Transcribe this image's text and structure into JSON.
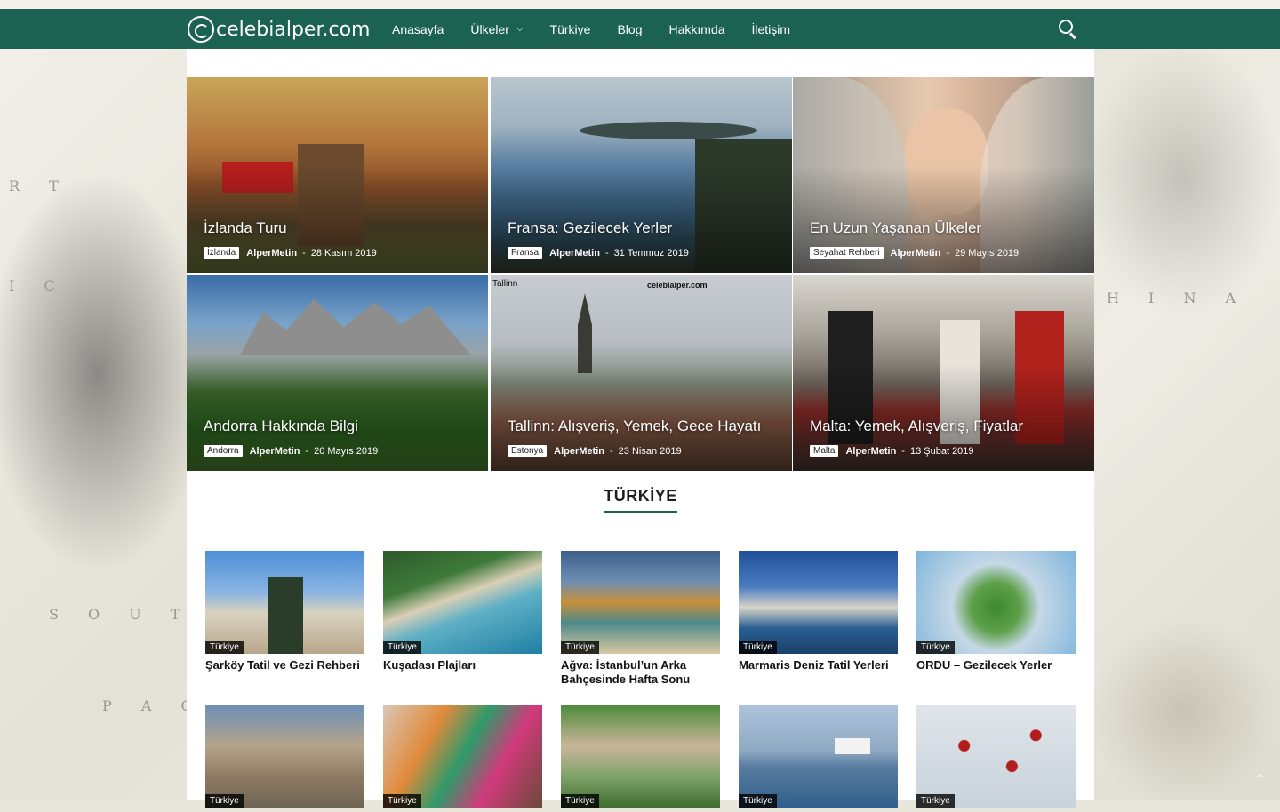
{
  "site": {
    "logo_text": "celebialper.com",
    "nav": [
      {
        "label": "Anasayfa"
      },
      {
        "label": "Ülkeler",
        "has_dropdown": true
      },
      {
        "label": "Türkiye"
      },
      {
        "label": "Blog"
      },
      {
        "label": "Hakkımda"
      },
      {
        "label": "İletişim"
      }
    ],
    "background_map_labels": [
      "R T",
      "I C",
      "S O U T H",
      "P A C I F",
      "H I N A"
    ],
    "theme_color": "#1b6253"
  },
  "featured": [
    {
      "title": "İzlanda Turu",
      "category": "İzlanda",
      "author": "AlperMetin",
      "date": "28 Kasım 2019"
    },
    {
      "title": "Fransa: Gezilecek Yerler",
      "category": "Fransa",
      "author": "AlperMetin",
      "date": "31 Temmuz 2019"
    },
    {
      "title": "En Uzun Yaşanan Ülkeler",
      "category": "Seyahat Rehberi",
      "author": "AlperMetin",
      "date": "29 Mayıs 2019"
    },
    {
      "title": "Andorra Hakkında Bilgi",
      "category": "Andorra",
      "author": "AlperMetin",
      "date": "20 Mayıs 2019"
    },
    {
      "title": "Tallinn: Alışveriş, Yemek, Gece Hayatı",
      "category": "Estonya",
      "author": "AlperMetin",
      "date": "23 Nisan 2019",
      "image_text": {
        "left": "Tallinn",
        "right": "celebialper.com"
      }
    },
    {
      "title": "Malta: Yemek, Alışveriş, Fiyatlar",
      "category": "Malta",
      "author": "AlperMetin",
      "date": "13 Şubat 2019"
    }
  ],
  "section": {
    "title": "TÜRKİYE",
    "cards": [
      {
        "badge": "Türkiye",
        "title": "Şarköy Tatil ve Gezi Rehberi"
      },
      {
        "badge": "Türkiye",
        "title": "Kuşadası Plajları"
      },
      {
        "badge": "Türkiye",
        "title": "Ağva: İstanbul’un Arka Bahçesinde Hafta Sonu"
      },
      {
        "badge": "Türkiye",
        "title": "Marmaris Deniz Tatil Yerleri"
      },
      {
        "badge": "Türkiye",
        "title": "ORDU – Gezilecek Yerler"
      },
      {
        "badge": "Türkiye",
        "title": ""
      },
      {
        "badge": "Türkiye",
        "title": ""
      },
      {
        "badge": "Türkiye",
        "title": ""
      },
      {
        "badge": "Türkiye",
        "title": ""
      },
      {
        "badge": "Türkiye",
        "title": ""
      }
    ]
  }
}
